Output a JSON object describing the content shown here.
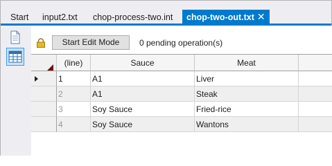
{
  "tabs": [
    {
      "label": "Start",
      "active": false
    },
    {
      "label": "input2.txt",
      "active": false
    },
    {
      "label": "chop-process-two.int",
      "active": false
    },
    {
      "label": "chop-two-out.txt",
      "active": true,
      "close_glyph": "✕"
    }
  ],
  "rail": {
    "items": [
      {
        "icon": "document-icon",
        "selected": false
      },
      {
        "icon": "table-grid-icon",
        "selected": true
      }
    ]
  },
  "toolbar": {
    "lock_icon": "lock-icon",
    "edit_button_label": "Start Edit Mode",
    "pending_text": "0 pending operation(s)"
  },
  "grid": {
    "columns": [
      "(line)",
      "Sauce",
      "Meat"
    ],
    "rows": [
      {
        "line": "1",
        "sauce": "A1",
        "meat": "Liver",
        "current": true
      },
      {
        "line": "2",
        "sauce": "A1",
        "meat": "Steak",
        "current": false
      },
      {
        "line": "3",
        "sauce": "Soy Sauce",
        "meat": "Fried-rice",
        "current": false
      },
      {
        "line": "4",
        "sauce": "Soy Sauce",
        "meat": "Wantons",
        "current": false
      }
    ]
  },
  "colors": {
    "accent": "#007acc",
    "chrome": "#eeeef2",
    "corner_marker": "#6b1515"
  }
}
